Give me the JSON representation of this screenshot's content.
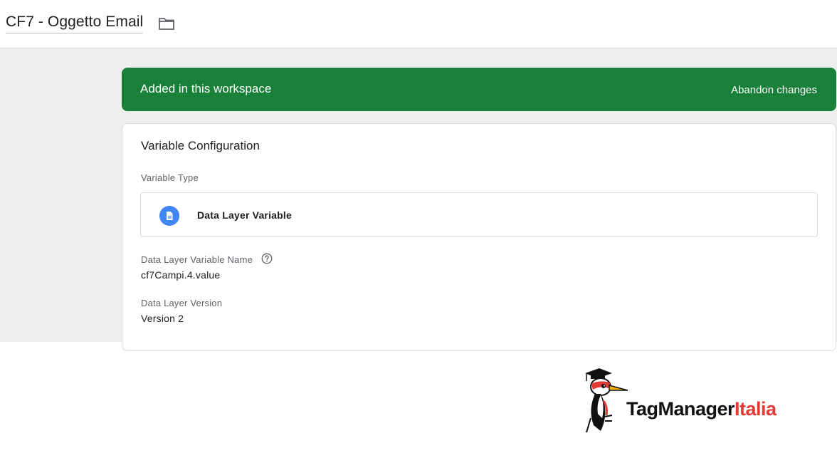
{
  "header": {
    "title": "CF7 - Oggetto Email",
    "folder_icon": "folder-icon"
  },
  "banner": {
    "text": "Added in this workspace",
    "action_label": "Abandon changes",
    "color": "#188038"
  },
  "card": {
    "title": "Variable Configuration",
    "variable_type_label": "Variable Type",
    "variable_type": {
      "name": "Data Layer Variable",
      "icon": "document-icon",
      "icon_color": "#4285f4"
    },
    "dl_name_label": "Data Layer Variable Name",
    "dl_name_help_icon": "help-icon",
    "dl_name_value": "cf7Campi.4.value",
    "dl_version_label": "Data Layer Version",
    "dl_version_value": "Version 2"
  },
  "logo": {
    "text_part1": "TagManager",
    "text_part2": "Italia",
    "color_part1": "#111111",
    "color_part2": "#e53935"
  }
}
